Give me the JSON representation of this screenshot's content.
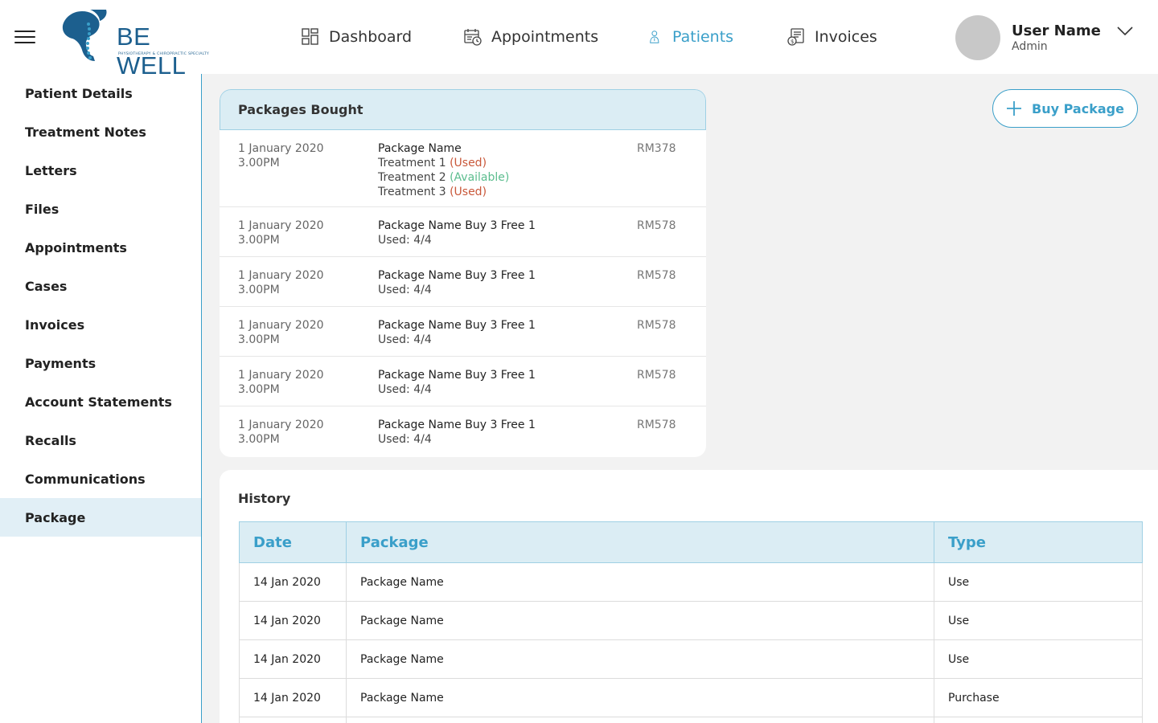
{
  "header": {
    "logo_text": "BE WELL",
    "logo_subtitle": "PHYSIOTHERAPY & CHIROPRACTIC SPECIALTY",
    "nav": [
      {
        "label": "Dashboard",
        "icon": "dashboard-icon",
        "active": false
      },
      {
        "label": "Appointments",
        "icon": "calendar-icon",
        "active": false
      },
      {
        "label": "Patients",
        "icon": "patient-icon",
        "active": true
      },
      {
        "label": "Invoices",
        "icon": "invoice-icon",
        "active": false
      }
    ],
    "user": {
      "name": "User Name",
      "role": "Admin"
    }
  },
  "sidebar": {
    "items": [
      {
        "label": "Patient Details"
      },
      {
        "label": "Treatment Notes"
      },
      {
        "label": "Letters"
      },
      {
        "label": "Files"
      },
      {
        "label": "Appointments"
      },
      {
        "label": "Cases"
      },
      {
        "label": "Invoices"
      },
      {
        "label": "Payments"
      },
      {
        "label": "Account Statements"
      },
      {
        "label": "Recalls"
      },
      {
        "label": "Communications"
      },
      {
        "label": "Package"
      }
    ],
    "active_index": 11
  },
  "packages": {
    "title": "Packages Bought",
    "first": {
      "date": "1 January 2020",
      "time": "3.00PM",
      "name": "Package Name",
      "treatments": [
        {
          "label": "Treatment 1",
          "status": "(Used)",
          "state": "used"
        },
        {
          "label": "Treatment 2",
          "status": "(Available)",
          "state": "available"
        },
        {
          "label": "Treatment 3",
          "status": "(Used)",
          "state": "used"
        }
      ],
      "price": "RM378"
    },
    "rows": [
      {
        "date": "1 January 2020",
        "time": "3.00PM",
        "name": "Package Name Buy 3 Free 1",
        "used": "Used: 4/4",
        "price": "RM578"
      },
      {
        "date": "1 January 2020",
        "time": "3.00PM",
        "name": "Package Name Buy 3 Free 1",
        "used": "Used: 4/4",
        "price": "RM578"
      },
      {
        "date": "1 January 2020",
        "time": "3.00PM",
        "name": "Package Name Buy 3 Free 1",
        "used": "Used: 4/4",
        "price": "RM578"
      },
      {
        "date": "1 January 2020",
        "time": "3.00PM",
        "name": "Package Name Buy 3 Free 1",
        "used": "Used: 4/4",
        "price": "RM578"
      },
      {
        "date": "1 January 2020",
        "time": "3.00PM",
        "name": "Package Name Buy 3 Free 1",
        "used": "Used: 4/4",
        "price": "RM578"
      }
    ]
  },
  "buy_button": {
    "label": "Buy Package"
  },
  "history": {
    "title": "History",
    "columns": [
      "Date",
      "Package",
      "Type"
    ],
    "rows": [
      {
        "date": "14 Jan 2020",
        "package": "Package Name",
        "type": "Use"
      },
      {
        "date": "14 Jan 2020",
        "package": "Package Name",
        "type": "Use"
      },
      {
        "date": "14 Jan 2020",
        "package": "Package Name",
        "type": "Use"
      },
      {
        "date": "14 Jan 2020",
        "package": "Package Name",
        "type": "Purchase"
      },
      {
        "date": "",
        "package": "",
        "type": ""
      }
    ]
  },
  "colors": {
    "accent": "#3a9fc9",
    "used": "#c9583a",
    "available": "#5bbd8e",
    "header_bg": "#dbedf4"
  }
}
